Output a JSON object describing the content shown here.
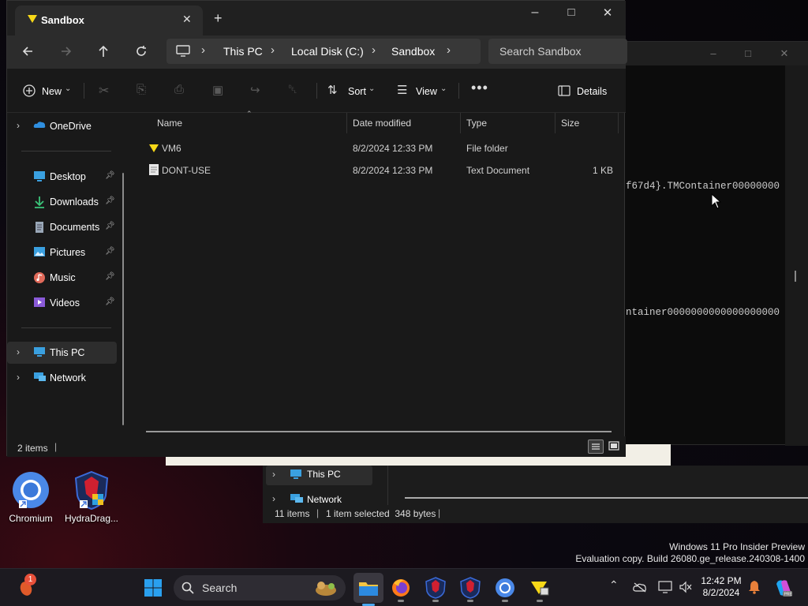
{
  "explorer": {
    "tab_title": "Sandbox",
    "breadcrumb": [
      "This PC",
      "Local Disk (C:)",
      "Sandbox"
    ],
    "search_placeholder": "Search Sandbox",
    "toolbar": {
      "new_label": "New",
      "sort_label": "Sort",
      "view_label": "View",
      "details_label": "Details"
    },
    "nav": {
      "onedrive": "OneDrive",
      "quick": [
        {
          "label": "Desktop",
          "icon": "desktop-icon"
        },
        {
          "label": "Downloads",
          "icon": "downloads-icon"
        },
        {
          "label": "Documents",
          "icon": "documents-icon"
        },
        {
          "label": "Pictures",
          "icon": "pictures-icon"
        },
        {
          "label": "Music",
          "icon": "music-icon"
        },
        {
          "label": "Videos",
          "icon": "videos-icon"
        }
      ],
      "this_pc": "This PC",
      "network": "Network"
    },
    "columns": {
      "name": "Name",
      "date": "Date modified",
      "type": "Type",
      "size": "Size"
    },
    "files": [
      {
        "name": "VM6",
        "date": "8/2/2024 12:33 PM",
        "type": "File folder",
        "size": "",
        "icon": "folder-icon"
      },
      {
        "name": "DONT-USE",
        "date": "8/2/2024 12:33 PM",
        "type": "Text Document",
        "size": "1 KB",
        "icon": "text-file-icon"
      }
    ],
    "status": "2 items"
  },
  "console": {
    "line1": "f67d4}.TMContainer00000000",
    "line2": "ntainer0000000000000000000"
  },
  "bg_explorer": {
    "nav_this_pc": "This PC",
    "nav_network": "Network",
    "status_items": "11 items",
    "status_selected": "1 item selected  348 bytes"
  },
  "desktop": {
    "icons": [
      {
        "label": "Chromium",
        "icon": "chromium-icon"
      },
      {
        "label": "HydraDrag...",
        "icon": "hydradragon-icon"
      }
    ]
  },
  "watermark": {
    "line1": "Windows 11 Pro Insider Preview",
    "line2": "Evaluation copy. Build 26080.ge_release.240308-1400"
  },
  "taskbar": {
    "search_label": "Search",
    "time": "12:42 PM",
    "date": "8/2/2024",
    "notification_count": "1"
  }
}
